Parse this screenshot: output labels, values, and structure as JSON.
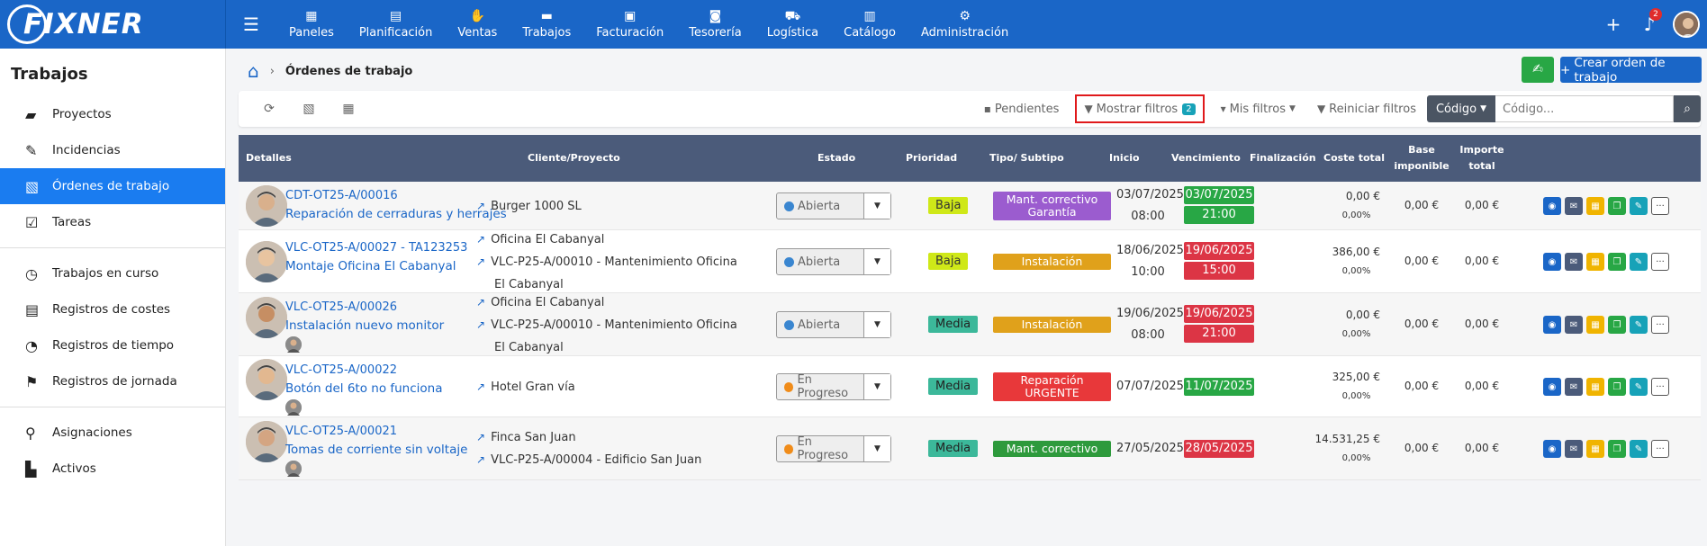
{
  "brand": "FIXNER",
  "nav": [
    {
      "icon": "▦",
      "label": "Paneles"
    },
    {
      "icon": "▤",
      "label": "Planificación"
    },
    {
      "icon": "✋",
      "label": "Ventas"
    },
    {
      "icon": "▬",
      "label": "Trabajos"
    },
    {
      "icon": "▣",
      "label": "Facturación"
    },
    {
      "icon": "◙",
      "label": "Tesorería"
    },
    {
      "icon": "⛟",
      "label": "Logística"
    },
    {
      "icon": "▥",
      "label": "Catálogo"
    },
    {
      "icon": "⚙",
      "label": "Administración"
    }
  ],
  "topbar": {
    "notif_count": "2"
  },
  "sidebar": {
    "title": "Trabajos",
    "groups": [
      [
        {
          "icon": "▰",
          "label": "Proyectos"
        },
        {
          "icon": "✎",
          "label": "Incidencias"
        },
        {
          "icon": "▧",
          "label": "Órdenes de trabajo",
          "active": true
        },
        {
          "icon": "☑",
          "label": "Tareas"
        }
      ],
      [
        {
          "icon": "◷",
          "label": "Trabajos en curso"
        },
        {
          "icon": "▤",
          "label": "Registros de costes"
        },
        {
          "icon": "◔",
          "label": "Registros de tiempo"
        },
        {
          "icon": "⚑",
          "label": "Registros de jornada"
        }
      ],
      [
        {
          "icon": "⚲",
          "label": "Asignaciones"
        },
        {
          "icon": "▙",
          "label": "Activos"
        }
      ]
    ]
  },
  "breadcrumb": {
    "current": "Órdenes de trabajo"
  },
  "actions": {
    "create_label": "Crear orden de trabajo"
  },
  "toolbar": {
    "pending": "Pendientes",
    "show_filters": "Mostrar filtros",
    "filter_count": "2",
    "my_filters": "Mis filtros",
    "reset_filters": "Reiniciar filtros",
    "code_select": "Código",
    "code_placeholder": "Código..."
  },
  "table": {
    "headers": {
      "detalles": "Detalles",
      "cliente": "Cliente/Proyecto",
      "estado": "Estado",
      "prioridad": "Prioridad",
      "tipo": "Tipo/ Subtipo",
      "inicio": "Inicio",
      "vencimiento": "Vencimiento",
      "finalizacion": "Finalización",
      "coste": "Coste total",
      "base1": "Base",
      "base2": "imponible",
      "importe1": "Importe",
      "importe2": "total"
    },
    "rows": [
      {
        "code": "CDT-OT25-A/00016",
        "title": "Reparación de cerraduras y herrajes",
        "clients": [
          "Burger 1000 SL"
        ],
        "client_cont": "",
        "status": "Abierta",
        "status_color": "#3a86d0",
        "priority": "Baja",
        "priority_bg": "#cfe818",
        "priority_fg": "#333",
        "tipo": [
          "Mant. correctivo",
          "Garantía"
        ],
        "tipo_bg": "#9b5ccf",
        "start_date": "03/07/2025",
        "start_time": "08:00",
        "due_date": "03/07/2025",
        "due_time": "21:00",
        "due_bg": "#28a745",
        "cost": "0,00 €",
        "cost_pct": "0,00%",
        "base": "0,00 €",
        "total": "0,00 €",
        "mini": false
      },
      {
        "code": "VLC-OT25-A/00027 - TA123253",
        "title": "Montaje Oficina El Cabanyal",
        "clients": [
          "Oficina El Cabanyal",
          "VLC-P25-A/00010 - Mantenimiento Oficina"
        ],
        "client_cont": "El Cabanyal",
        "status": "Abierta",
        "status_color": "#3a86d0",
        "priority": "Baja",
        "priority_bg": "#cfe818",
        "priority_fg": "#333",
        "tipo": [
          "Instalación"
        ],
        "tipo_bg": "#e0a11b",
        "start_date": "18/06/2025",
        "start_time": "10:00",
        "due_date": "19/06/2025",
        "due_time": "15:00",
        "due_bg": "#dc3545",
        "cost": "386,00 €",
        "cost_pct": "0,00%",
        "base": "0,00 €",
        "total": "0,00 €",
        "mini": false
      },
      {
        "code": "VLC-OT25-A/00026",
        "title": "Instalación nuevo monitor",
        "clients": [
          "Oficina El Cabanyal",
          "VLC-P25-A/00010 - Mantenimiento Oficina"
        ],
        "client_cont": "El Cabanyal",
        "status": "Abierta",
        "status_color": "#3a86d0",
        "priority": "Media",
        "priority_bg": "#3cb89a",
        "priority_fg": "#222",
        "tipo": [
          "Instalación"
        ],
        "tipo_bg": "#e0a11b",
        "start_date": "19/06/2025",
        "start_time": "08:00",
        "due_date": "19/06/2025",
        "due_time": "21:00",
        "due_bg": "#dc3545",
        "cost": "0,00 €",
        "cost_pct": "0,00%",
        "base": "0,00 €",
        "total": "0,00 €",
        "mini": true
      },
      {
        "code": "VLC-OT25-A/00022",
        "title": "Botón del 6to no funciona",
        "clients": [
          "Hotel Gran vía"
        ],
        "client_cont": "",
        "status": "En Progreso",
        "status_color": "#f08c1a",
        "priority": "Media",
        "priority_bg": "#3cb89a",
        "priority_fg": "#222",
        "tipo": [
          "Reparación",
          "URGENTE"
        ],
        "tipo_bg": "#e8383a",
        "start_date": "07/07/2025",
        "start_time": "",
        "due_date": "11/07/2025",
        "due_time": "",
        "due_bg": "#28a745",
        "cost": "325,00 €",
        "cost_pct": "0,00%",
        "base": "0,00 €",
        "total": "0,00 €",
        "mini": true
      },
      {
        "code": "VLC-OT25-A/00021",
        "title": "Tomas de corriente sin voltaje",
        "clients": [
          "Finca San Juan",
          "VLC-P25-A/00004 - Edificio San Juan"
        ],
        "client_cont": "",
        "status": "En Progreso",
        "status_color": "#f08c1a",
        "priority": "Media",
        "priority_bg": "#3cb89a",
        "priority_fg": "#222",
        "tipo": [
          "Mant. correctivo"
        ],
        "tipo_bg": "#2e9a3c",
        "start_date": "27/05/2025",
        "start_time": "",
        "due_date": "28/05/2025",
        "due_time": "",
        "due_bg": "#dc3545",
        "cost": "14.531,25 €",
        "cost_pct": "0,00%",
        "base": "0,00 €",
        "total": "0,00 €",
        "mini": true
      }
    ],
    "row_actions": [
      {
        "name": "view",
        "icon": "◉",
        "color": "#1a66c7"
      },
      {
        "name": "email",
        "icon": "✉",
        "color": "#4b5b7a"
      },
      {
        "name": "print",
        "icon": "▦",
        "color": "#f0b400"
      },
      {
        "name": "copy",
        "icon": "❐",
        "color": "#28a745"
      },
      {
        "name": "edit",
        "icon": "✎",
        "color": "#17a2b8"
      },
      {
        "name": "more",
        "icon": "···",
        "color": "#ffffff"
      }
    ]
  }
}
